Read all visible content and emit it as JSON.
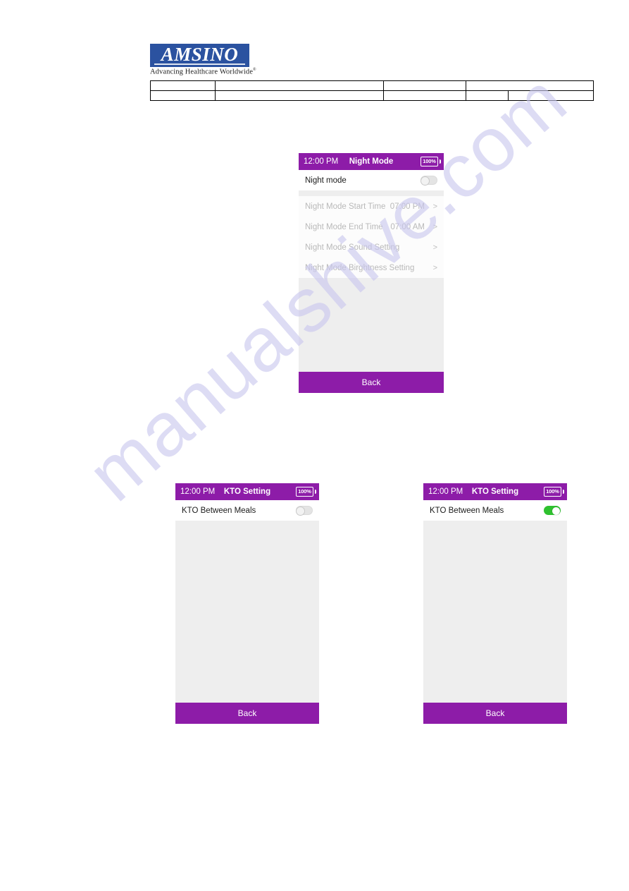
{
  "document": {
    "logo": {
      "wordmark": "AMSINO",
      "tagline": "Advancing Healthcare Worldwide",
      "registered_mark": "®",
      "brand_color": "#2b52a0"
    },
    "header_table": {
      "rows": [
        [
          "",
          "",
          "",
          ""
        ],
        [
          "",
          "",
          "",
          "",
          ""
        ]
      ]
    }
  },
  "watermark": {
    "text": "manualshive.com",
    "color": "#c9c7ee"
  },
  "theme": {
    "accent_purple": "#8d1ca8",
    "toggle_on_green": "#2fc12f",
    "toggle_off_gray": "#e4e4e4",
    "screen_bg": "#eeeeee",
    "card_bg": "#ffffff",
    "disabled_text": "#b9b9b9"
  },
  "screens": [
    {
      "id": "night-mode",
      "status_bar": {
        "time": "12:00 PM",
        "title": "Night Mode",
        "battery": "100%"
      },
      "primary_row": {
        "label": "Night mode",
        "toggle_state": "off"
      },
      "settings_rows": [
        {
          "label": "Night Mode Start Time",
          "value": "07:00 PM",
          "chevron": ">",
          "enabled": false
        },
        {
          "label": "Night Mode End Time",
          "value": "07:00 AM",
          "chevron": ">",
          "enabled": false
        },
        {
          "label": "Night Mode Sound Setting",
          "value": "",
          "chevron": ">",
          "enabled": false
        },
        {
          "label": "Night Mode Birghtness Setting",
          "value": "",
          "chevron": ">",
          "enabled": false
        }
      ],
      "back_label": "Back"
    },
    {
      "id": "kto-setting-off",
      "status_bar": {
        "time": "12:00 PM",
        "title": "KTO Setting",
        "battery": "100%"
      },
      "primary_row": {
        "label": "KTO Between Meals",
        "toggle_state": "off"
      },
      "settings_rows": [],
      "back_label": "Back"
    },
    {
      "id": "kto-setting-on",
      "status_bar": {
        "time": "12:00 PM",
        "title": "KTO Setting",
        "battery": "100%"
      },
      "primary_row": {
        "label": "KTO Between Meals",
        "toggle_state": "on"
      },
      "settings_rows": [],
      "back_label": "Back"
    }
  ]
}
